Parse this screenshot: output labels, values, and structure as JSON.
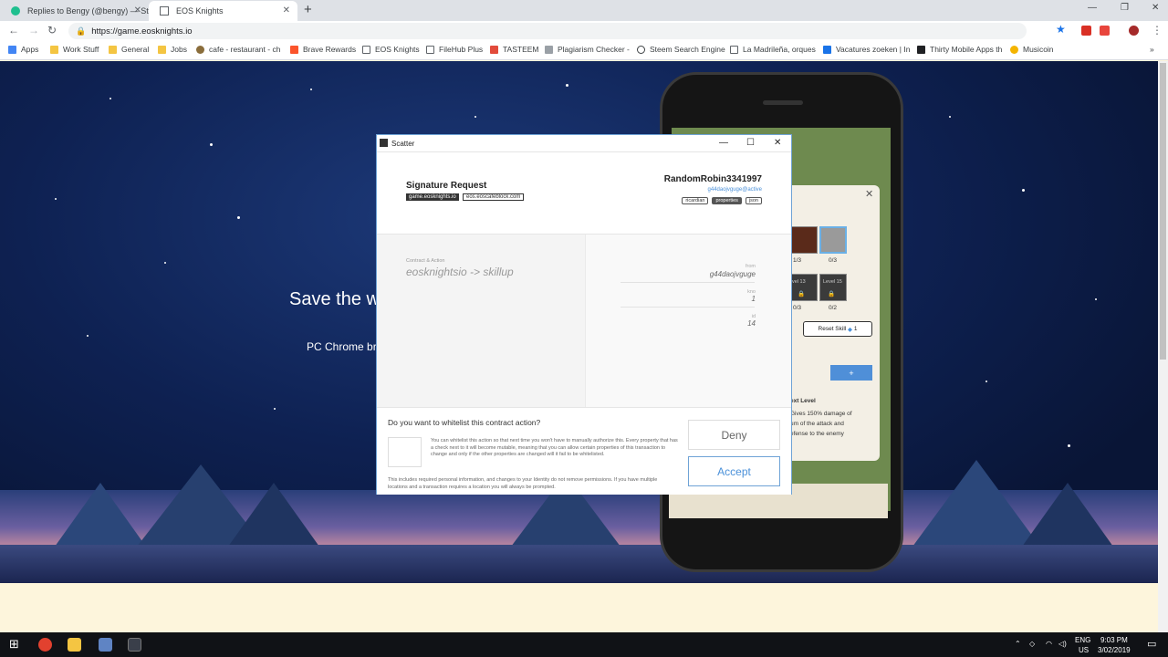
{
  "browser": {
    "tabs": [
      {
        "title": "Replies to Bengy (@bengy) — St",
        "close": "✕"
      },
      {
        "title": "EOS Knights",
        "close": "✕"
      }
    ],
    "new_tab": "+",
    "window_controls": {
      "minimize": "—",
      "restore": "❐",
      "close": "✕"
    },
    "url": "https://game.eosknights.io",
    "bookmarks": [
      "Apps",
      "Work Stuff",
      "General",
      "Jobs",
      "cafe - restaurant - ch",
      "Brave Rewards",
      "EOS Knights",
      "FileHub Plus",
      "TASTEEM",
      "Plagiarism Checker -",
      "Steem Search Engine",
      "La Madrileña, orques",
      "Vacatures zoeken | In",
      "Thirty Mobile Apps th",
      "Musicoin"
    ],
    "bookmarks_more": "»"
  },
  "page": {
    "hero_title": "Save the w",
    "hero_sub": "PC Chrome br"
  },
  "game": {
    "slot_counts": [
      "1/3",
      "0/3",
      "0/3",
      "0/2"
    ],
    "levels": [
      "vel 13",
      "Level 15"
    ],
    "reset_label": "Reset Skill",
    "reset_count": "1",
    "plus_label": "+",
    "next_level": "ext Level",
    "desc_lines": [
      "Gives 150% damage of",
      "um of the attack and",
      "efense to the enemy"
    ]
  },
  "dialog": {
    "window_title": "Scatter",
    "signature_title": "Signature Request",
    "origin_chip": "game.eosknights.io",
    "network_chip": "eos.eoscafeblock.com",
    "account_name": "RandomRobin3341997",
    "account_perm": "g44daojvguge@active",
    "view_tabs": [
      "ricardian",
      "properties",
      "json"
    ],
    "contract_label": "Contract & Action",
    "contract_value": "eosknightsio -> skillup",
    "fields": [
      {
        "label": "from",
        "value": "g44daojvguge"
      },
      {
        "label": "kno",
        "value": "1"
      },
      {
        "label": "id",
        "value": "14"
      }
    ],
    "whitelist_question": "Do you want to whitelist this contract action?",
    "whitelist_desc": "You can whitelist this action so that next time you won't have to manually authorize this. Every property that has a check next to it will become mutable, meaning that you can allow certain properties of this transaction to change and only if the other properties are changed will it fail to be whitelisted.",
    "whitelist_note": "This includes required personal information, and changes to your Identity do not remove permissions. If you have multiple locations and a transaction requires a location you will always be prompted.",
    "deny_label": "Deny",
    "accept_label": "Accept"
  },
  "taskbar": {
    "lang": "ENG",
    "region": "US",
    "time": "9:03 PM",
    "date": "3/02/2019"
  }
}
